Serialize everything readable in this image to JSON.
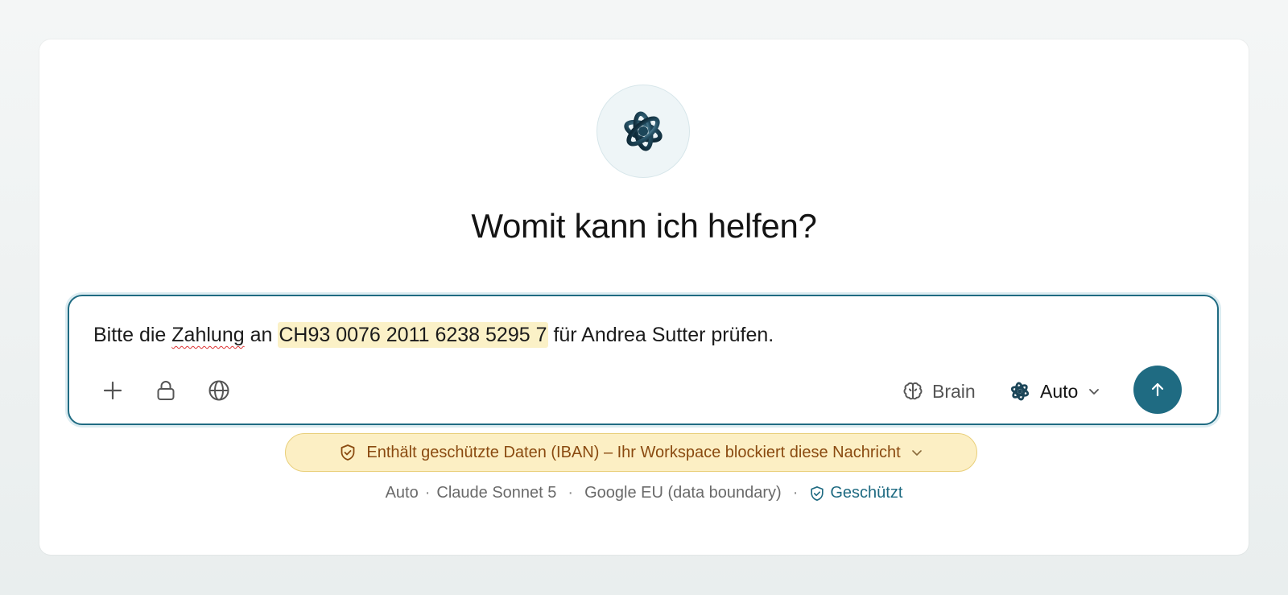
{
  "main": {
    "heading": "Womit kann ich helfen?"
  },
  "composer": {
    "text_before_squiggle": "Bitte die ",
    "squiggle_word": "Zahlung",
    "text_mid": " an ",
    "iban_highlight": "CH93 0076 2011 6238 5295 7",
    "text_after": " für Andrea Sutter prüfen.",
    "brain_label": "Brain",
    "model_label": "Auto"
  },
  "warning": {
    "text": "Enthält geschützte Daten (IBAN) – Ihr Workspace blockiert diese Nachricht"
  },
  "footer": {
    "mode": "Auto",
    "model": "Claude Sonnet 5",
    "region": "Google EU (data boundary)",
    "status": "Geschützt",
    "sep1": "·",
    "sep2": "·",
    "sep3": "·"
  },
  "colors": {
    "accent": "#1f6b82",
    "warning_bg": "#fcefc4",
    "warning_text": "#8a4a10",
    "iban_highlight": "#fbf1c7"
  },
  "icons": [
    "logo-icon",
    "plus-icon",
    "lock-icon",
    "globe-icon",
    "brain-icon",
    "chevron-down-icon",
    "arrow-up-icon",
    "shield-check-icon"
  ]
}
